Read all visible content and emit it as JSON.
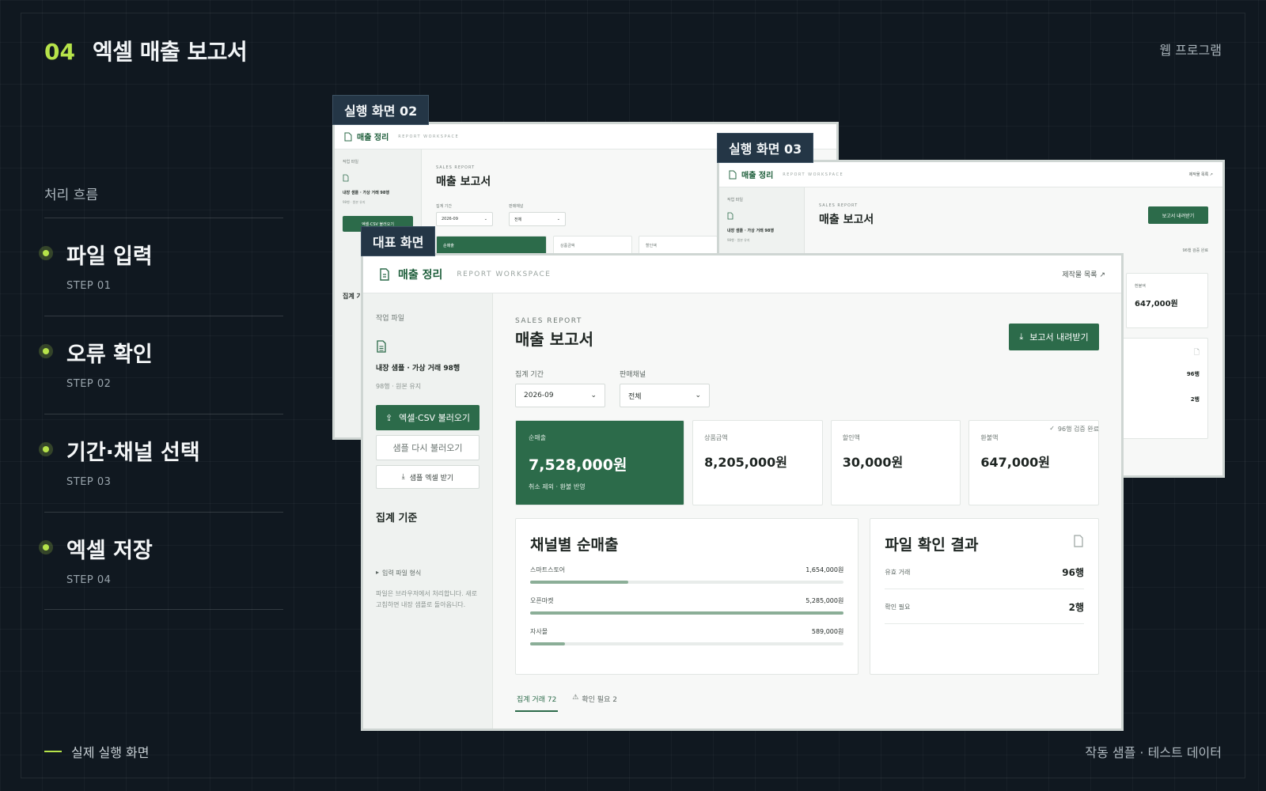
{
  "slide": {
    "number": "04",
    "title": "엑셀 매출 보고서",
    "corner_tag": "웹 프로그램",
    "flow_heading": "처리 흐름",
    "steps": [
      {
        "title": "파일 입력",
        "step": "STEP 01"
      },
      {
        "title": "오류 확인",
        "step": "STEP 02"
      },
      {
        "title": "기간·채널 선택",
        "step": "STEP 03"
      },
      {
        "title": "엑셀 저장",
        "step": "STEP 04"
      }
    ],
    "footer_left": "실제 실행 화면",
    "footer_right": "작동 샘플 · 테스트 데이터"
  },
  "tags": {
    "main": "대표 화면",
    "screen2": "실행 화면 02",
    "screen3": "실행 화면 03"
  },
  "app": {
    "brand": "매출 정리",
    "workspace": "REPORT WORKSPACE",
    "top_link": "제작물 목록 ↗",
    "sidebar": {
      "section": "작업 파일",
      "file_name": "내장 샘플 · 가상 거래 98행",
      "file_meta": "98행 · 원본 유지",
      "upload_button": "엑셀·CSV 불러오기",
      "reload_button": "샘플 다시 불러오기",
      "sample_button": "샘플 엑셀 받기",
      "criteria_title": "집계 기준",
      "format_toggle": "입력 파일 형식",
      "note": "파일은 브라우저에서 처리합니다. 새로고침하면 내장 샘플로 돌아옵니다."
    },
    "report": {
      "eyebrow": "SALES REPORT",
      "title": "매출 보고서",
      "download_button": "보고서 내려받기",
      "period_label": "집계 기간",
      "period_value": "2026-09",
      "channel_label": "판매채널",
      "channel_value": "전체",
      "verified": "96행 검증 완료"
    },
    "kpis": [
      {
        "label": "순매출",
        "value": "7,528,000원",
        "sub": "취소 제외 · 환불 반영"
      },
      {
        "label": "상품금액",
        "value": "8,205,000원"
      },
      {
        "label": "할인액",
        "value": "30,000원"
      },
      {
        "label": "환불액",
        "value": "647,000원"
      }
    ],
    "channels": {
      "title": "채널별 순매출",
      "items": [
        {
          "name": "스마트스토어",
          "value": "1,654,000원",
          "ratio": 0.313
        },
        {
          "name": "오픈마켓",
          "value": "5,285,000원",
          "ratio": 1.0
        },
        {
          "name": "자사몰",
          "value": "589,000원",
          "ratio": 0.111
        }
      ]
    },
    "file_check": {
      "title": "파일 확인 결과",
      "rows": [
        {
          "label": "유효 거래",
          "value": "96행"
        },
        {
          "label": "확인 필요",
          "value": "2행"
        }
      ]
    },
    "tabs": [
      {
        "label": "집계 거래 72"
      },
      {
        "label": "확인 필요 2"
      }
    ]
  },
  "colors": {
    "accent": "#b6e34a",
    "brand_green": "#2c6b4a",
    "background": "#101820"
  }
}
